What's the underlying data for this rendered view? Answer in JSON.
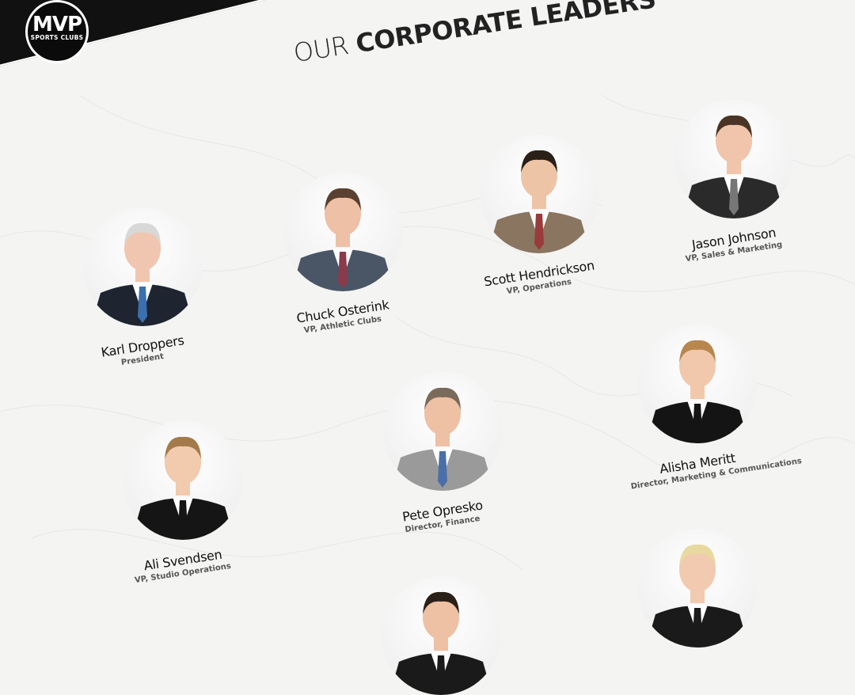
{
  "brand": {
    "logo_big": "MVP",
    "logo_small": "SPORTS CLUBS"
  },
  "heading": {
    "light": "OUR",
    "bold": "CORPORATE LEADERS"
  },
  "colors": {
    "header_bg": "#111111",
    "page_bg": "#f4f4f3",
    "text": "#111111",
    "subtext": "#555555"
  },
  "leaders": [
    {
      "name": "Karl Droppers",
      "role": "President",
      "suit": "#1e2430",
      "tie": "#3a6fb0",
      "hair": "#d8d8d8",
      "skin": "#f0c6b0"
    },
    {
      "name": "Chuck Osterink",
      "role": "VP, Athletic Clubs",
      "suit": "#4a5566",
      "tie": "#8a3a4a",
      "hair": "#5a4030",
      "skin": "#eec0a6"
    },
    {
      "name": "Scott Hendrickson",
      "role": "VP, Operations",
      "suit": "#8a7560",
      "tie": "#9a3b3b",
      "hair": "#2a2018",
      "skin": "#eec4a6"
    },
    {
      "name": "Jason Johnson",
      "role": "VP, Sales & Marketing",
      "suit": "#2a2a2a",
      "tie": "#777777",
      "hair": "#4a3525",
      "skin": "#f1c4ac"
    },
    {
      "name": "Ali Svendsen",
      "role": "VP, Studio Operations",
      "suit": "#151515",
      "tie": "#151515",
      "hair": "#a47a4a",
      "skin": "#f2caae"
    },
    {
      "name": "Pete Opresko",
      "role": "Director, Finance",
      "suit": "#9a9a9a",
      "tie": "#4a6fa8",
      "hair": "#7a6a5a",
      "skin": "#eec0a4"
    },
    {
      "name": "Alisha Meritt",
      "role": "Director, Marketing & Communications",
      "suit": "#141414",
      "tie": "#141414",
      "hair": "#b8874e",
      "skin": "#f1c8ac"
    },
    {
      "name": "",
      "role": "",
      "suit": "#1a1a1a",
      "tie": "#1a1a1a",
      "hair": "#2a2018",
      "skin": "#eec0a4"
    },
    {
      "name": "",
      "role": "",
      "suit": "#1a1a1a",
      "tie": "#1a1a1a",
      "hair": "#e8d9a0",
      "skin": "#f2cab0"
    }
  ]
}
